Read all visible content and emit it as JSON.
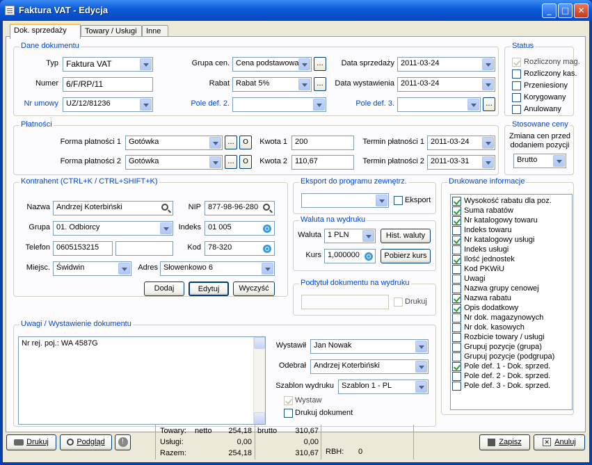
{
  "window": {
    "title": "Faktura VAT - Edycja"
  },
  "tabs": [
    "Dok. sprzedaży",
    "Towary / Usługi",
    "Inne"
  ],
  "dane": {
    "legend": "Dane dokumentu",
    "typ_label": "Typ",
    "typ": "Faktura VAT",
    "numer_label": "Numer",
    "numer": "6/F/RP/11",
    "nr_umowy_label": "Nr umowy",
    "nr_umowy": "UZ/12/81236",
    "grupa_label": "Grupa cen.",
    "grupa": "Cena podstawowa",
    "rabat_label": "Rabat",
    "rabat": "Rabat 5%",
    "pole2_label": "Pole def. 2.",
    "pole2": "",
    "data_sprz_label": "Data sprzedaży",
    "data_sprz": "2011-03-24",
    "data_wyst_label": "Data wystawienia",
    "data_wyst": "2011-03-24",
    "pole3_label": "Pole def. 3.",
    "pole3": "",
    "dots": "..."
  },
  "status": {
    "legend": "Status",
    "items": [
      {
        "label": "Rozliczony mag.",
        "checked": true,
        "disabled": true
      },
      {
        "label": "Rozliczony kas.",
        "checked": false,
        "disabled": false
      },
      {
        "label": "Przeniesiony",
        "checked": false,
        "disabled": false
      },
      {
        "label": "Korygowany",
        "checked": false,
        "disabled": false
      },
      {
        "label": "Anulowany",
        "checked": false,
        "disabled": false
      }
    ]
  },
  "platnosci": {
    "legend": "Płatności",
    "forma1_label": "Forma płatności 1",
    "forma1": "Gotówka",
    "forma2_label": "Forma płatności 2",
    "forma2": "Gotówka",
    "kwota1_label": "Kwota 1",
    "kwota1": "200",
    "kwota2_label": "Kwota 2",
    "kwota2": "110,67",
    "termin1_label": "Termin płatności 1",
    "termin1": "2011-03-24",
    "termin2_label": "Termin płatności 2",
    "termin2": "2011-03-31",
    "o": "O"
  },
  "ceny": {
    "legend": "Stosowane ceny",
    "desc1": "Zmiana cen przed",
    "desc2": "dodaniem pozycji",
    "value": "Brutto"
  },
  "kontrahent": {
    "legend": "Kontrahent (CTRL+K / CTRL+SHIFT+K)",
    "nazwa_label": "Nazwa",
    "nazwa": "Andrzej Koterbiński",
    "nip_label": "NIP",
    "nip": "877-98-96-280",
    "grupa_label": "Grupa",
    "grupa": "01. Odbiorcy",
    "indeks_label": "Indeks",
    "indeks": "01 005",
    "telefon_label": "Telefon",
    "telefon": "0605153215",
    "telefon2": "",
    "kod_label": "Kod",
    "kod": "78-320",
    "miejsc_label": "Miejsc.",
    "miejsc": "Świdwin",
    "adres_label": "Adres",
    "adres": "Słowenkowo 6",
    "dodaj": "Dodaj",
    "edytuj": "Edytuj",
    "wyczysc": "Wyczyść"
  },
  "eksport": {
    "legend": "Eksport do programu zewnętrz.",
    "value": "",
    "chk_label": "Eksport"
  },
  "waluta": {
    "legend": "Waluta na wydruku",
    "waluta_label": "Waluta",
    "waluta": "1 PLN",
    "hist": "Hist. waluty",
    "kurs_label": "Kurs",
    "kurs": "1,000000",
    "pobierz": "Pobierz kurs"
  },
  "podtytul": {
    "legend": "Podtytuł dokumentu na wydruku",
    "value": "",
    "drukuj": "Drukuj"
  },
  "drukowane": {
    "legend": "Drukowane informacje",
    "items": [
      {
        "label": "Wysokość rabatu dla poz.",
        "checked": true
      },
      {
        "label": "Suma rabatów",
        "checked": true
      },
      {
        "label": "Nr katalogowy towaru",
        "checked": true
      },
      {
        "label": "Indeks towaru",
        "checked": false
      },
      {
        "label": "Nr katalogowy usługi",
        "checked": true
      },
      {
        "label": "Indeks usługi",
        "checked": false
      },
      {
        "label": "Ilość jednostek",
        "checked": true
      },
      {
        "label": "Kod PKWiU",
        "checked": false
      },
      {
        "label": "Uwagi",
        "checked": false
      },
      {
        "label": "Nazwa grupy cenowej",
        "checked": false
      },
      {
        "label": "Nazwa rabatu",
        "checked": true
      },
      {
        "label": "Opis dodatkowy",
        "checked": true
      },
      {
        "label": "Nr dok. magazynowych",
        "checked": false
      },
      {
        "label": "Nr dok. kasowych",
        "checked": false
      },
      {
        "label": "Rozbicie towary / usługi",
        "checked": false
      },
      {
        "label": "Grupuj pozycje (grupa)",
        "checked": false
      },
      {
        "label": "Grupuj pozycje (podgrupa)",
        "checked": false
      },
      {
        "label": "Pole def. 1 - Dok. sprzed.",
        "checked": true
      },
      {
        "label": "Pole def. 2 - Dok. sprzed.",
        "checked": false
      },
      {
        "label": "Pole def. 3 - Dok. sprzed.",
        "checked": false
      }
    ]
  },
  "uwagi": {
    "legend": "Uwagi / Wystawienie dokumentu",
    "text": "Nr rej. poj.: WA 4587G",
    "wystawil_label": "Wystawił",
    "wystawil": "Jan Nowak",
    "odebral_label": "Odebrał",
    "odebral": "Andrzej Koterbiński",
    "szablon_label": "Szablon wydruku",
    "szablon": "Szablon 1 - PL",
    "wystaw": "Wystaw",
    "drukuj_dok": "Drukuj dokument"
  },
  "footer": {
    "drukuj": "Drukuj",
    "podglad": "Podgląd",
    "zapisz": "Zapisz",
    "anuluj": "Anuluj",
    "towary_label": "Towary:",
    "netto_label": "netto",
    "netto_t": "254,18",
    "brutto_label": "brutto",
    "brutto_t": "310,67",
    "uslugi_label": "Usługi:",
    "netto_u": "0,00",
    "brutto_u": "0,00",
    "razem_label": "Razem:",
    "netto_r": "254,18",
    "brutto_r": "310,67",
    "rbh_label": "RBH:",
    "rbh": "0"
  }
}
